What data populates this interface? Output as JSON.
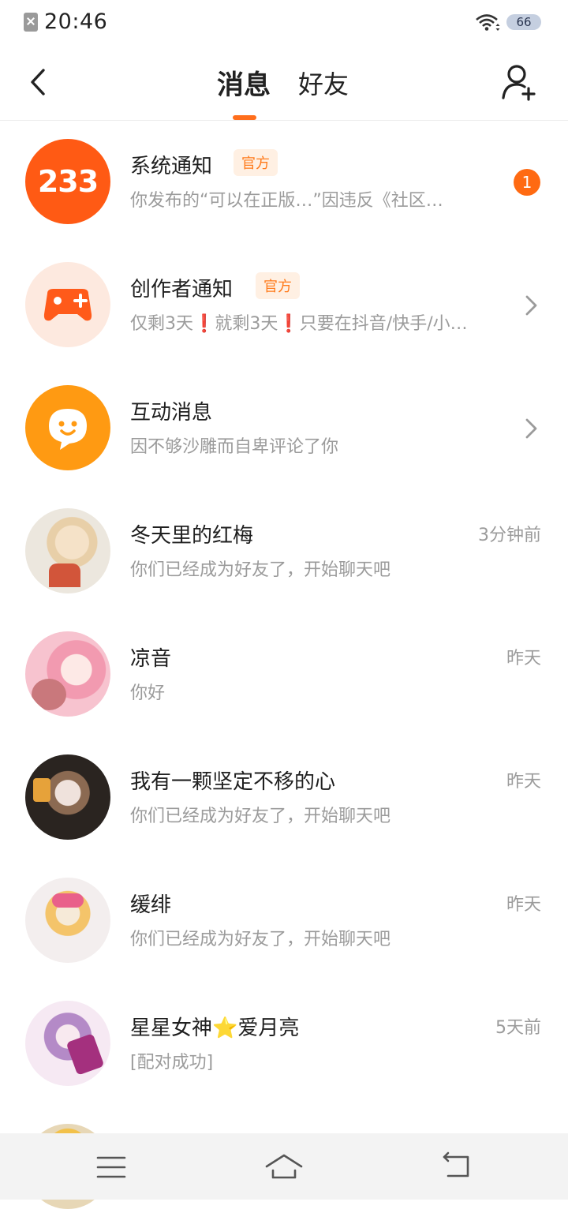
{
  "status_bar": {
    "time": "20:46",
    "battery": "66"
  },
  "header": {
    "tabs": [
      {
        "label": "消息"
      },
      {
        "label": "好友"
      }
    ]
  },
  "conversations": [
    {
      "name": "系统通知",
      "official_badge": "官方",
      "preview": "你发布的“可以在正版…”因违反《社区…",
      "unread": "1",
      "avatar_text": "233"
    },
    {
      "name": "创作者通知",
      "official_badge": "官方",
      "preview": "仅剩3天❗就剩3天❗只要在抖音/快手/小…"
    },
    {
      "name": "互动消息",
      "preview": "因不够沙雕而自卑评论了你"
    },
    {
      "name": "冬天里的红梅",
      "preview": "你们已经成为好友了，开始聊天吧",
      "time": "3分钟前"
    },
    {
      "name": "凉音",
      "preview": "你好",
      "time": "昨天"
    },
    {
      "name": "我有一颗坚定不移的心",
      "preview": "你们已经成为好友了，开始聊天吧",
      "time": "昨天"
    },
    {
      "name": "缓绯",
      "preview": "你们已经成为好友了，开始聊天吧",
      "time": "昨天"
    },
    {
      "name": "星星女神⭐爱月亮",
      "preview": "[配对成功]",
      "time": "5天前"
    }
  ],
  "colors": {
    "accent": "#ff6e1c",
    "badge_bg": "#fff0e3",
    "muted_text": "#9b9b9b"
  }
}
